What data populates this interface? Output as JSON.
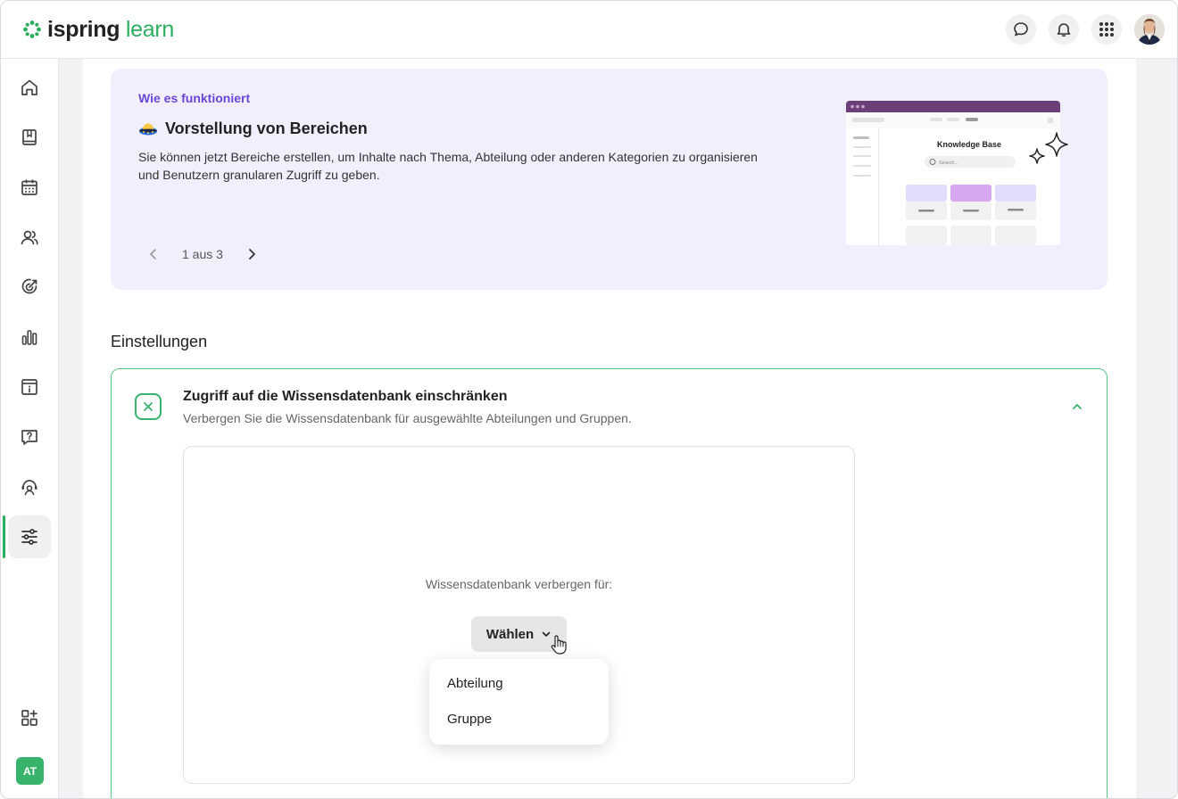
{
  "brand": {
    "name_part1": "ispring",
    "name_part2": "learn",
    "accent": "#2bae5f"
  },
  "header": {
    "icons": [
      "chat-icon",
      "bell-icon",
      "apps-grid-icon"
    ],
    "avatar_alt": "user-avatar"
  },
  "sidebar": {
    "items": [
      {
        "icon": "home-icon"
      },
      {
        "icon": "book-icon"
      },
      {
        "icon": "calendar-icon"
      },
      {
        "icon": "users-icon"
      },
      {
        "icon": "target-icon"
      },
      {
        "icon": "bar-chart-icon"
      },
      {
        "icon": "info-panel-icon"
      },
      {
        "icon": "help-icon"
      },
      {
        "icon": "support-icon"
      },
      {
        "icon": "settings-sliders-icon",
        "active": true
      }
    ],
    "bottom_icon": "add-widget-icon",
    "user_initials": "AT",
    "user_color": "#37b36b"
  },
  "promo": {
    "kicker": "Wie es funktioniert",
    "title": "Vorstellung von Bereichen",
    "description": "Sie können jetzt Bereiche erstellen, um Inhalte nach Thema, Abteilung oder anderen Kategorien zu organisieren und Benutzern granularen Zugriff zu geben.",
    "pager": "1 aus 3",
    "mock_title": "Knowledge Base",
    "mock_search": "Search..."
  },
  "settings": {
    "section_title": "Einstellungen",
    "card_title": "Zugriff auf die Wissensdatenbank einschränken",
    "card_subtitle": "Verbergen Sie die Wissensdatenbank für ausgewählte Abteilungen und Gruppen.",
    "hide_label": "Wissensdatenbank verbergen für:",
    "select_label": "Wählen",
    "dropdown_options": [
      "Abteilung",
      "Gruppe"
    ]
  }
}
